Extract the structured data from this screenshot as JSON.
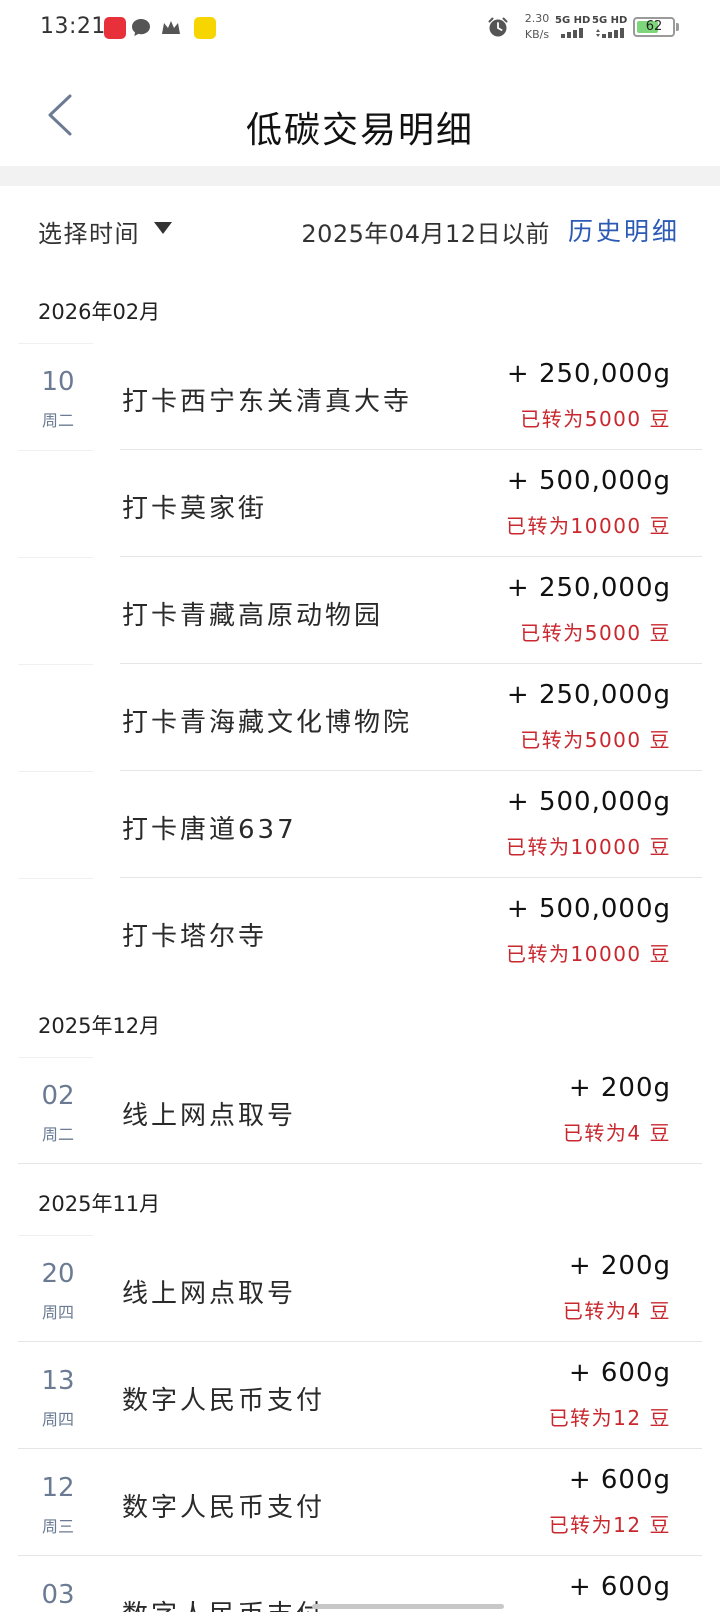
{
  "status": {
    "time": "13:21",
    "net_speed_value": "2.30",
    "net_speed_unit": "KB/s",
    "sim1_label": "5G HD",
    "sim2_label": "5G HD",
    "battery": "62",
    "battery_level": 0.62
  },
  "header": {
    "title": "低碳交易明细"
  },
  "filter": {
    "select_label": "选择时间",
    "before_date": "2025年04月12日以前",
    "history_link": "历史明细"
  },
  "groups": [
    {
      "month": "2026年02月",
      "items": [
        {
          "day": "10",
          "weekday": "周二",
          "title": "打卡西宁东关清真大寺",
          "amount": "+ 250,000g",
          "converted": "已转为5000 豆"
        },
        {
          "day": "",
          "weekday": "",
          "title": "打卡莫家街",
          "amount": "+ 500,000g",
          "converted": "已转为10000 豆"
        },
        {
          "day": "",
          "weekday": "",
          "title": "打卡青藏高原动物园",
          "amount": "+ 250,000g",
          "converted": "已转为5000 豆"
        },
        {
          "day": "",
          "weekday": "",
          "title": "打卡青海藏文化博物院",
          "amount": "+ 250,000g",
          "converted": "已转为5000 豆"
        },
        {
          "day": "",
          "weekday": "",
          "title": "打卡唐道637",
          "amount": "+ 500,000g",
          "converted": "已转为10000 豆"
        },
        {
          "day": "",
          "weekday": "",
          "title": "打卡塔尔寺",
          "amount": "+ 500,000g",
          "converted": "已转为10000 豆"
        }
      ]
    },
    {
      "month": "2025年12月",
      "items": [
        {
          "day": "02",
          "weekday": "周二",
          "title": "线上网点取号",
          "amount": "+ 200g",
          "converted": "已转为4 豆"
        }
      ]
    },
    {
      "month": "2025年11月",
      "items": [
        {
          "day": "20",
          "weekday": "周四",
          "title": "线上网点取号",
          "amount": "+ 200g",
          "converted": "已转为4 豆"
        },
        {
          "day": "13",
          "weekday": "周四",
          "title": "数字人民币支付",
          "amount": "+ 600g",
          "converted": "已转为12 豆"
        },
        {
          "day": "12",
          "weekday": "周三",
          "title": "数字人民币支付",
          "amount": "+ 600g",
          "converted": "已转为12 豆"
        },
        {
          "day": "03",
          "weekday": "",
          "title": "数字人民币支付",
          "amount": "+ 600g",
          "converted": ""
        }
      ]
    }
  ],
  "colors": {
    "accent_blue": "#2b5ab5",
    "converted_red": "#c8282e",
    "date_gray_blue": "#6b7b93"
  },
  "icons": {
    "back": "chevron-left-icon",
    "dropdown": "triangle-down-icon",
    "alarm": "alarm-clock-icon"
  }
}
